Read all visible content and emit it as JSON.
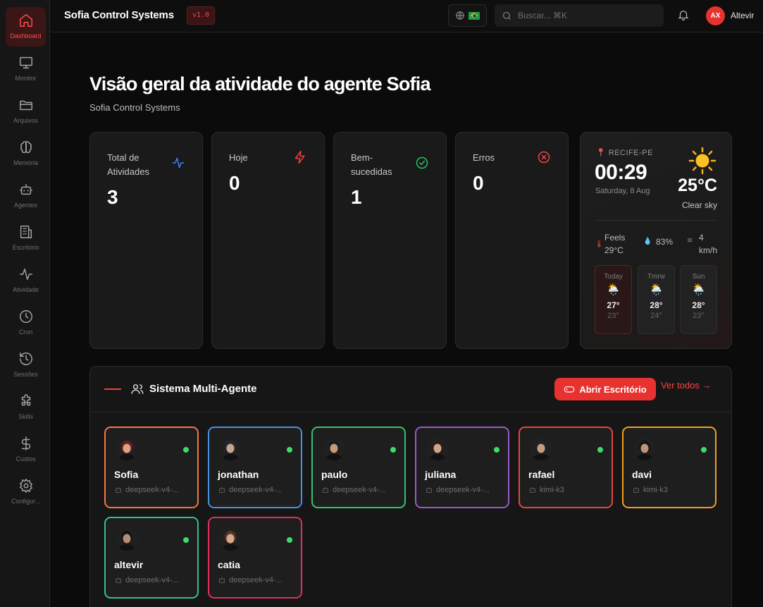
{
  "sidebar": {
    "items": [
      {
        "label": "Dashboard",
        "icon": "home-icon",
        "active": true
      },
      {
        "label": "Monitor",
        "icon": "monitor-icon"
      },
      {
        "label": "Arquivos",
        "icon": "folder-icon"
      },
      {
        "label": "Memória",
        "icon": "brain-icon"
      },
      {
        "label": "Agentes",
        "icon": "bot-icon"
      },
      {
        "label": "Escritório",
        "icon": "building-icon"
      },
      {
        "label": "Atividade",
        "icon": "activity-icon"
      },
      {
        "label": "Cron",
        "icon": "clock-icon"
      },
      {
        "label": "Sessões",
        "icon": "history-icon"
      },
      {
        "label": "Skills",
        "icon": "puzzle-icon"
      },
      {
        "label": "Custos",
        "icon": "dollar-icon"
      },
      {
        "label": "Configur...",
        "icon": "settings-icon"
      }
    ]
  },
  "topbar": {
    "app_title": "Sofia Control Systems",
    "version": "v1.0",
    "search_placeholder": "Buscar... ⌘K",
    "user_initials": "AX",
    "user_name": "Altevir"
  },
  "header": {
    "title": "Visão geral da atividade do agente Sofia",
    "subtitle": "Sofia Control Systems"
  },
  "stats": [
    {
      "label": "Total de Atividades",
      "value": "3",
      "icon": "activity-icon",
      "color": "#3b82f6"
    },
    {
      "label": "Hoje",
      "value": "0",
      "icon": "zap-icon",
      "color": "#ef4444"
    },
    {
      "label": "Bem-sucedidas",
      "value": "1",
      "icon": "check-circle-icon",
      "color": "#22c55e"
    },
    {
      "label": "Erros",
      "value": "0",
      "icon": "x-circle-icon",
      "color": "#ef4444"
    }
  ],
  "weather": {
    "location": "RECIFE-PE",
    "time": "00:29",
    "date": "Saturday, 8 Aug",
    "temp": "25°C",
    "condition": "Clear sky",
    "feels_label": "Feels",
    "feels": "29°C",
    "humidity": "83%",
    "wind_value": "4",
    "wind_unit": "km/h",
    "forecast": [
      {
        "day": "Today",
        "icon": "🌦️",
        "high": "27°",
        "low": "23°"
      },
      {
        "day": "Tmrw",
        "icon": "🌦️",
        "high": "28°",
        "low": "24°"
      },
      {
        "day": "Sun",
        "icon": "🌦️",
        "high": "28°",
        "low": "23°"
      }
    ]
  },
  "agents_panel": {
    "title": "Sistema Multi-Agente",
    "open_button": "Abrir Escritório",
    "see_all": "Ver todos →",
    "agents": [
      {
        "name": "Sofia",
        "model": "deepseek-v4-...",
        "color": "#f97343",
        "skin": "#d9a38a",
        "hair": "#6b1f1a"
      },
      {
        "name": "jonathan",
        "model": "deepseek-v4-...",
        "color": "#4a90d9",
        "skin": "#c9a48c",
        "hair": "#1f2a33"
      },
      {
        "name": "paulo",
        "model": "deepseek-v4-...",
        "color": "#34c46e",
        "skin": "#c49a7c",
        "hair": "#1a1a1a"
      },
      {
        "name": "juliana",
        "model": "deepseek-v4-...",
        "color": "#9b59c9",
        "skin": "#d2a48a",
        "hair": "#2b1d16"
      },
      {
        "name": "rafael",
        "model": "kimi-k3",
        "color": "#e0483e",
        "skin": "#c49b80",
        "hair": "#222"
      },
      {
        "name": "davi",
        "model": "kimi-k3",
        "color": "#f0a020",
        "skin": "#c09478",
        "hair": "#151515"
      },
      {
        "name": "altevir",
        "model": "deepseek-v4-...",
        "color": "#2fbf9a",
        "skin": "#b78d72",
        "hair": "#141414"
      },
      {
        "name": "catia",
        "model": "deepseek-v4-...",
        "color": "#e0305a",
        "skin": "#d6a88c",
        "hair": "#5a3426"
      }
    ]
  }
}
